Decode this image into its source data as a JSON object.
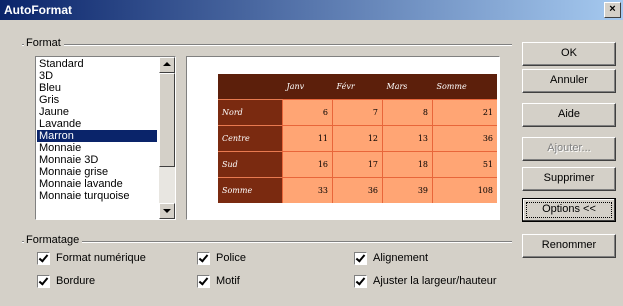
{
  "window": {
    "title": "AutoFormat",
    "close_glyph": "×"
  },
  "format_group": {
    "label": "Format",
    "items": [
      "Standard",
      "3D",
      "Bleu",
      "Gris",
      "Jaune",
      "Lavande",
      "Marron",
      "Monnaie",
      "Monnaie 3D",
      "Monnaie grise",
      "Monnaie lavande",
      "Monnaie turquoise"
    ],
    "selected": "Marron"
  },
  "preview": {
    "headers": [
      "",
      "Janv",
      "Févr",
      "Mars",
      "Somme"
    ],
    "rows": [
      {
        "label": "Nord",
        "values": [
          "6",
          "7",
          "8",
          "21"
        ]
      },
      {
        "label": "Centre",
        "values": [
          "11",
          "12",
          "13",
          "36"
        ]
      },
      {
        "label": "Sud",
        "values": [
          "16",
          "17",
          "18",
          "51"
        ]
      },
      {
        "label": "Somme",
        "values": [
          "33",
          "36",
          "39",
          "108"
        ]
      }
    ],
    "colors": {
      "header_bg": "#5c1f0b",
      "row_header_bg": "#7a2a10",
      "cell_bg": "#ffa574"
    }
  },
  "buttons": {
    "ok": "OK",
    "cancel": "Annuler",
    "help": "Aide",
    "add": "Ajouter...",
    "delete": "Supprimer",
    "options": "Options <<",
    "rename": "Renommer"
  },
  "formatting_group": {
    "label": "Formatage",
    "options": [
      {
        "label": "Format numérique",
        "checked": true
      },
      {
        "label": "Police",
        "checked": true
      },
      {
        "label": "Alignement",
        "checked": true
      },
      {
        "label": "Bordure",
        "checked": true
      },
      {
        "label": "Motif",
        "checked": true
      },
      {
        "label": "Ajuster la largeur/hauteur",
        "checked": true
      }
    ]
  }
}
